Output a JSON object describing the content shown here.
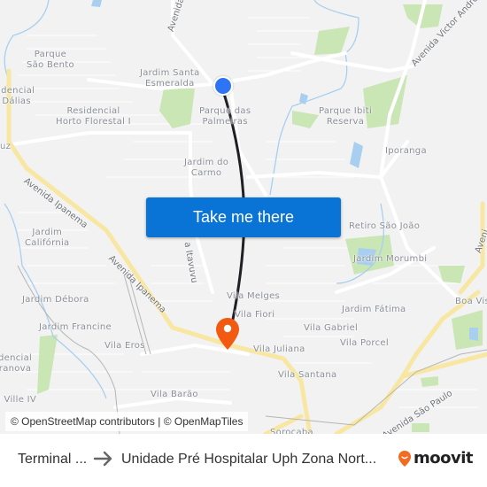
{
  "map": {
    "colors": {
      "background": "#f2f2f2",
      "park": "#c9e6b4",
      "water": "#a8cff0",
      "major_road": "#f8e7a2",
      "route_line": "#1f1f24",
      "origin": "#2f74f5",
      "destination": "#f25a12"
    },
    "places": [
      {
        "id": "parque-sao-bento",
        "text": "Parque\nSão Bento"
      },
      {
        "id": "jardim-santa-esmeralda",
        "text": "Jardim Santa\nEsmeralda"
      },
      {
        "id": "residencial-dalias",
        "text": "idencial\nDálias"
      },
      {
        "id": "residencial-horto-florestal",
        "text": "Residencial\nHorto Florestal I"
      },
      {
        "id": "parque-das-palmeiras",
        "text": "Parque das\nPalmeiras"
      },
      {
        "id": "parque-ibiti-reserva",
        "text": "Parque Ibiti\nReserva"
      },
      {
        "id": "iporanga",
        "text": "Iporanga"
      },
      {
        "id": "jardim-do-carmo",
        "text": "Jardim do\nCarmo"
      },
      {
        "id": "retiro-sao-joao",
        "text": "Retiro São João"
      },
      {
        "id": "jardim-california",
        "text": "Jardim\nCalifórnia"
      },
      {
        "id": "jardim-morumbi",
        "text": "Jardim Morumbi"
      },
      {
        "id": "vila-melges",
        "text": "Vila Melges"
      },
      {
        "id": "jardim-debora",
        "text": "Jardim Débora"
      },
      {
        "id": "jardim-fatima",
        "text": "Jardim Fátima"
      },
      {
        "id": "boa-vista",
        "text": "Boa Vis"
      },
      {
        "id": "vila-fiori",
        "text": "Vila Fiori"
      },
      {
        "id": "jardim-francine",
        "text": "Jardim Francine"
      },
      {
        "id": "vila-gabriel",
        "text": "Vila Gabriel"
      },
      {
        "id": "vila-eros",
        "text": "Vila Eros"
      },
      {
        "id": "vila-porcel",
        "text": "Vila Porcel"
      },
      {
        "id": "residencial-granova",
        "text": "dencial\nranova"
      },
      {
        "id": "vila-juliana",
        "text": "Vila Juliana"
      },
      {
        "id": "vila-santana",
        "text": "Vila Santana"
      },
      {
        "id": "vila-barao",
        "text": "Vila Barão"
      },
      {
        "id": "ville-iv",
        "text": "l Ville IV"
      },
      {
        "id": "luz",
        "text": "uz"
      },
      {
        "id": "sorocaba",
        "text": "Sorocaba"
      }
    ],
    "streets": [
      {
        "id": "avenida-top",
        "text": "Avenida"
      },
      {
        "id": "avenida-victor-andrew",
        "text": "Avenida Victor Andrew"
      },
      {
        "id": "avenida-ipanema-1",
        "text": "Avenida Ipanema"
      },
      {
        "id": "avenida-ipanema-2",
        "text": "Avenida Ipanema"
      },
      {
        "id": "avenida-itavuvu",
        "text": "a Itavuvu"
      },
      {
        "id": "avenida-right",
        "text": "Aveni"
      },
      {
        "id": "avenida-sao-paulo",
        "text": "Avenida São Paulo"
      }
    ],
    "cta_label": "Take me there",
    "attribution": "© OpenStreetMap contributors | © OpenMapTiles"
  },
  "footer": {
    "origin": "Terminal ...",
    "destination": "Unidade Pré Hospitalar Uph Zona Nort...",
    "brand": "moovit",
    "brand_color": "#f26b21"
  }
}
